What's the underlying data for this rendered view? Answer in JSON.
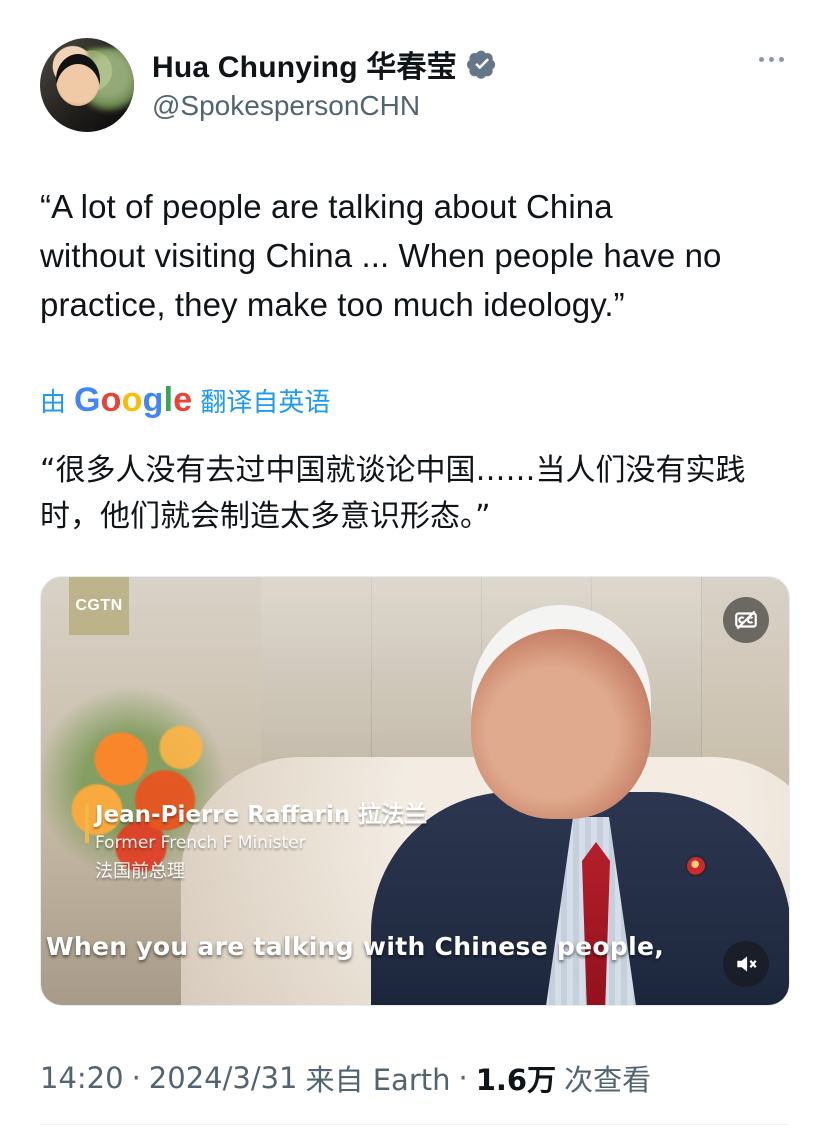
{
  "tweet": {
    "author": {
      "display_name": "Hua Chunying 华春莹",
      "handle": "@SpokespersonCHN",
      "verified": true
    },
    "text_lines": [
      "“A lot of people are talking about China",
      "without visiting China ... When people have no",
      "practice, they make too much ideology.”"
    ],
    "translation": {
      "prefix": "由",
      "provider": "Google",
      "suffix": "翻译自英语",
      "text_lines": [
        "“很多人没有去过中国就谈论中国……当人们没有实践",
        "时，他们就会制造太多意识形态。”"
      ]
    },
    "media": {
      "watermark": "CGTN",
      "lower_third": {
        "name": "Jean-Pierre Raffarin 拉法兰",
        "title": "Former French F    Minister",
        "cn": "法国前总理"
      },
      "subtitle": "When you are talking with Chinese people,"
    },
    "footer": {
      "time": "14:20",
      "date": "2024/3/31",
      "source": "来自 Earth",
      "views_value": "1.6万",
      "views_label": "次查看"
    },
    "icons": {
      "verified": "verified-badge-icon",
      "more": "more-options-icon",
      "cc": "closed-captions-icon",
      "mute": "mute-icon"
    },
    "colors": {
      "link_blue": "#1d9bf0",
      "text_primary": "#0f1419",
      "text_secondary": "#536471"
    }
  }
}
